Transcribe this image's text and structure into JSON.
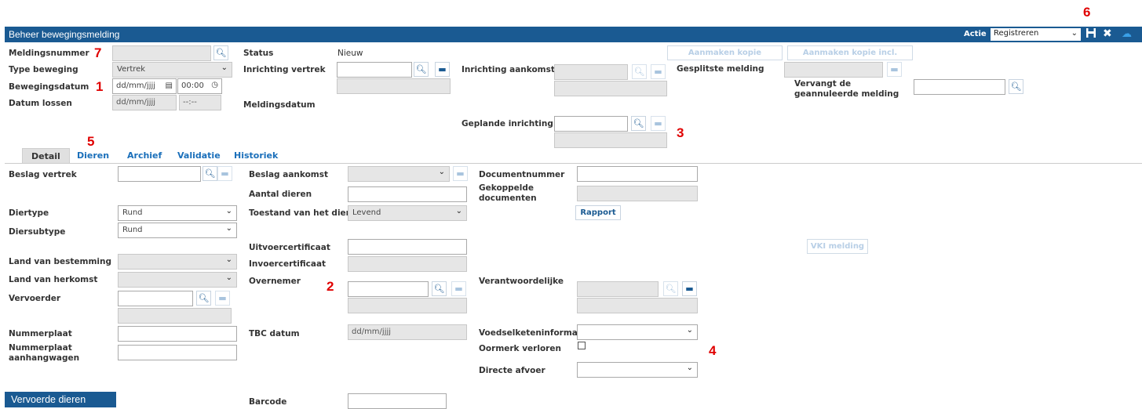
{
  "header": {
    "title": "Beheer bewegingsmelding",
    "actie_label": "Actie",
    "actie_value": "Registreren"
  },
  "markers": {
    "m1": "1",
    "m2": "2",
    "m3": "3",
    "m4": "4",
    "m5": "5",
    "m6": "6",
    "m7": "7"
  },
  "form": {
    "meldingsnummer": "Meldingsnummer",
    "type_beweging": "Type beweging",
    "type_beweging_value": "Vertrek",
    "bewegingsdatum": "Bewegingsdatum",
    "date_placeholder": "dd/mm/jjjj",
    "time_value": "00:00",
    "datum_lossen": "Datum lossen",
    "time_placeholder": "--:--",
    "status": "Status",
    "status_value": "Nieuw",
    "inrichting_vertrek": "Inrichting vertrek",
    "meldingsdatum": "Meldingsdatum",
    "inrichting_aankomst": "Inrichting aankomst",
    "geplande_inrichting": "Geplande inrichting",
    "aanmaken_kopie": "Aanmaken kopie",
    "aanmaken_kopie_dieren": "Aanmaken kopie incl. dieren",
    "gesplitste_melding": "Gesplitste melding",
    "vervangt": "Vervangt de geannuleerde melding"
  },
  "tabs": [
    "Detail",
    "Dieren",
    "Archief",
    "Validatie",
    "Historiek"
  ],
  "detail": {
    "beslag_vertrek": "Beslag vertrek",
    "diertype": "Diertype",
    "diertype_value": "Rund",
    "diersubtype": "Diersubtype",
    "diersubtype_value": "Rund",
    "land_bestemming": "Land van bestemming",
    "land_herkomst": "Land van herkomst",
    "vervoerder": "Vervoerder",
    "nummerplaat": "Nummerplaat",
    "nummerplaat_aanhang": "Nummerplaat aanhangwagen",
    "beslag_aankomst": "Beslag aankomst",
    "aantal_dieren": "Aantal dieren",
    "toestand": "Toestand van het dier",
    "toestand_value": "Levend",
    "uitvoercertificaat": "Uitvoercertificaat",
    "invoercertificaat": "Invoercertificaat",
    "overnemer": "Overnemer",
    "tbc_datum": "TBC datum",
    "barcode": "Barcode",
    "documentnummer": "Documentnummer",
    "gekoppelde": "Gekoppelde documenten",
    "rapport": "Rapport",
    "vki": "VKI melding",
    "verantwoordelijke": "Verantwoordelijke",
    "voedselketen": "Voedselketeninformatie",
    "oormerk": "Oormerk verloren",
    "directe_afvoer": "Directe afvoer"
  },
  "section_title": "Vervoerde dieren"
}
